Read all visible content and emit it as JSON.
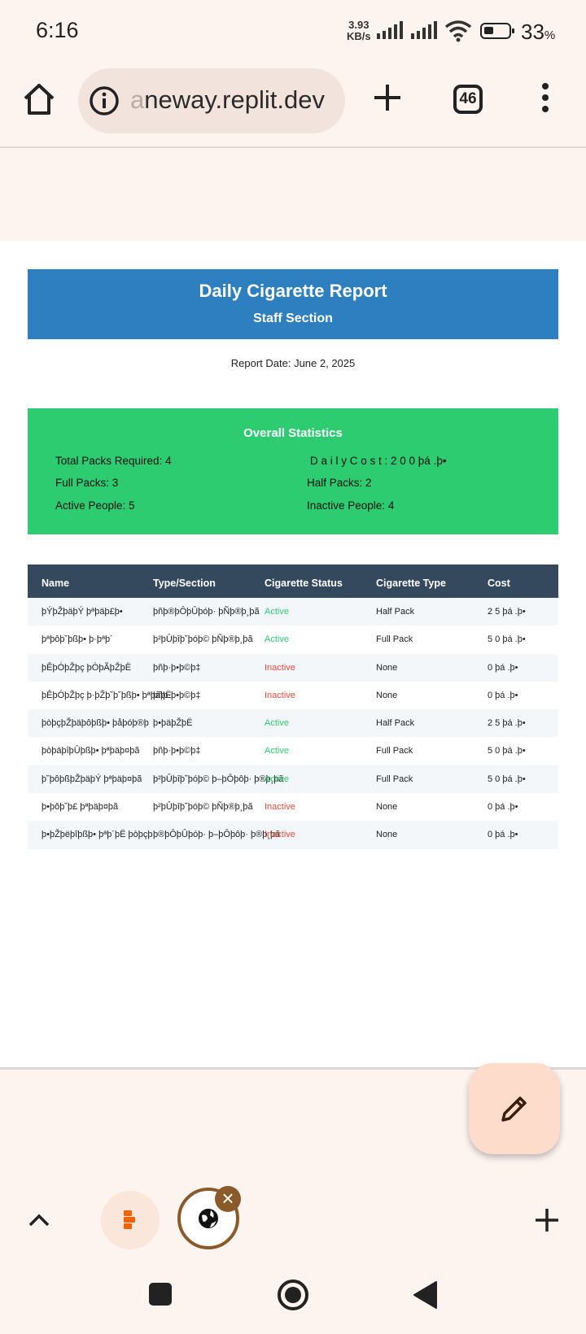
{
  "status_bar": {
    "time": "6:16",
    "net_speed_value": "3.93",
    "net_speed_unit": "KB/s",
    "battery_percent": "33",
    "battery_unit": "%"
  },
  "browser": {
    "url_faded": "a",
    "url": "neway.replit.dev",
    "tab_count": "46"
  },
  "report": {
    "title": "Daily Cigarette Report",
    "subtitle": "Staff Section",
    "date": "Report Date: June 2, 2025",
    "stats": {
      "heading": "Overall Statistics",
      "total_packs": "Total Packs Required: 4",
      "daily_cost": "D a i l y  C o s t :  2 0 0  þá .þ•",
      "full_packs": "Full Packs: 3",
      "half_packs": "Half Packs: 2",
      "active_people": "Active People: 5",
      "inactive_people": "Inactive People: 4"
    },
    "table": {
      "headers": [
        "Name",
        "Type/Section",
        "Cigarette Status",
        "Cigarette Type",
        "Cost"
      ],
      "rows": [
        {
          "name": "þÝþŽþäþÝ  þªþäþ£þ•",
          "type": "þñþ®þÔþÛþóþ·  þÑþ®þ¸þã",
          "status": "Active",
          "ctype": "Half Pack",
          "cost": "2 5  þá .þ•"
        },
        {
          "name": "þªþôþ˘þßþ•  þ·þªþ´",
          "type": "þ²þÛþîþ˘þóþ©  þÑþ®þ¸þã",
          "status": "Active",
          "ctype": "Full Pack",
          "cost": "5 0  þá .þ•"
        },
        {
          "name": "þÊþÓþŽþç  þÒþÃþŽþË",
          "type": "þñþ·þ•þ©þ‡",
          "status": "Inactive",
          "ctype": "None",
          "cost": "0  þá .þ•"
        },
        {
          "name": "þÊþÓþŽþç  þ·þŽþ˘þ˘þßþ•  þªþãþË",
          "type": "þñþ·þ•þ©þ‡",
          "status": "Inactive",
          "ctype": "None",
          "cost": "0  þá .þ•"
        },
        {
          "name": "þòþçþŽþäþôþßþ•  þåþóþ®þ",
          "type": "þ•þäþŽþË",
          "status": "Active",
          "ctype": "Half Pack",
          "cost": "2 5  þá .þ•"
        },
        {
          "name": "þòþäþîþÛþßþ•  þªþäþ¤þã",
          "type": "þñþ·þ•þ©þ‡",
          "status": "Active",
          "ctype": "Full Pack",
          "cost": "5 0  þá .þ•"
        },
        {
          "name": "þ˘þôþßþŽþäþÝ  þªþäþ¤þã",
          "type": "þ²þÛþîþ˘þóþ©  þ–þÔþôþ·  þ®þ¸þã",
          "status": "Active",
          "ctype": "Full Pack",
          "cost": "5 0  þá .þ•"
        },
        {
          "name": "þ•þôþ˘þ£  þªþäþ¤þã",
          "type": "þ²þÛþîþ˘þóþ©  þÑþ®þ¸þã",
          "status": "Inactive",
          "ctype": "None",
          "cost": "0  þá .þ•"
        },
        {
          "name": "þ•þŽþëþîþßþ•  þªþ´þË  þòþçþ",
          "type": "þ®þÔþÛþóþ·  þ–þÔþôþ·  þ®þ¸þã",
          "status": "Inactive",
          "ctype": "None",
          "cost": "0  þá .þ•"
        }
      ]
    }
  },
  "colors": {
    "header_blue": "#2e7fbf",
    "stats_green": "#2ecc71",
    "table_header": "#34495e",
    "active": "#2ecc71",
    "inactive": "#e74c3c"
  }
}
